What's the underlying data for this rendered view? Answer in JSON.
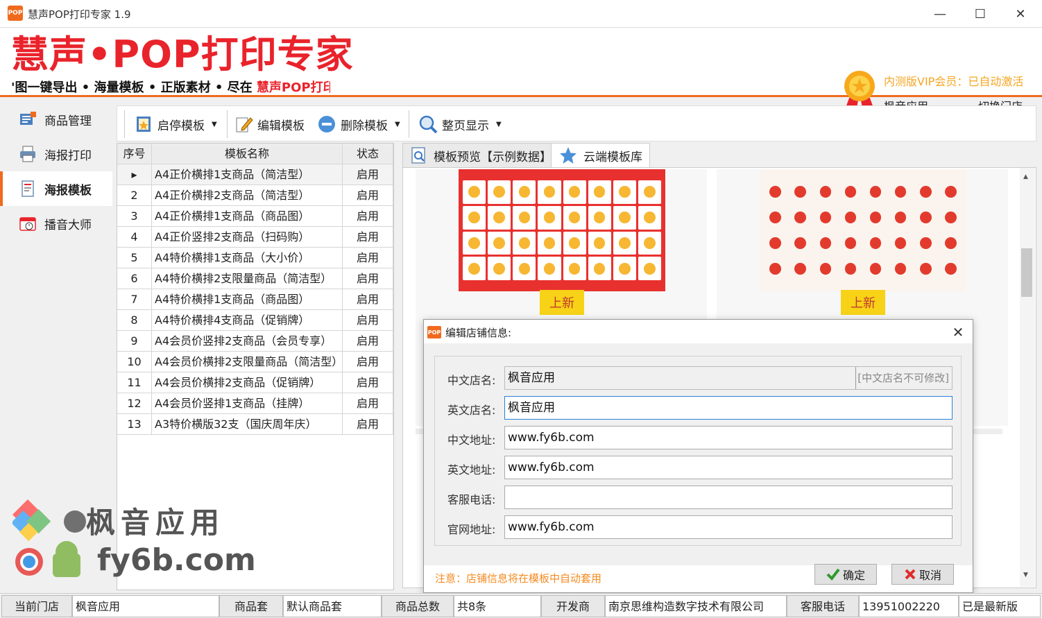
{
  "window": {
    "title": "慧声POP打印专家 1.9",
    "icon_text": "POP"
  },
  "header": {
    "logo": "慧声•POP打印专家",
    "slogan_prefix": "'图一键导出 • 海量模板 • 正版素材 • 尽在 ",
    "slogan_highlight": "慧声POP打印",
    "vip_text": "内测版VIP会员：已自动激活",
    "store_name": "枫音应用",
    "switch_store": "切换门店"
  },
  "sidebar": {
    "items": [
      {
        "label": "商品管理",
        "icon": "goods-icon"
      },
      {
        "label": "海报打印",
        "icon": "printer-icon"
      },
      {
        "label": "海报模板",
        "icon": "template-icon",
        "active": true
      },
      {
        "label": "播音大师",
        "icon": "broadcast-icon"
      }
    ]
  },
  "toolbar": {
    "toggle_label": "启停模板",
    "edit_label": "编辑模板",
    "delete_label": "删除模板",
    "zoom_label": "整页显示"
  },
  "grid": {
    "headers": [
      "序号",
      "模板名称",
      "状态"
    ],
    "rows": [
      [
        "▸",
        "A4正价横排1支商品（简洁型）",
        "启用"
      ],
      [
        "2",
        "A4正价横排2支商品（简洁型）",
        "启用"
      ],
      [
        "3",
        "A4正价横排1支商品（商品图）",
        "启用"
      ],
      [
        "4",
        "A4正价竖排2支商品（扫码购）",
        "启用"
      ],
      [
        "5",
        "A4特价横排1支商品（大小价）",
        "启用"
      ],
      [
        "6",
        "A4特价横排2支限量商品（简洁型）",
        "启用"
      ],
      [
        "7",
        "A4特价横排1支商品（商品图）",
        "启用"
      ],
      [
        "8",
        "A4特价横排4支商品（促销牌）",
        "启用"
      ],
      [
        "9",
        "A4会员价竖排2支商品（会员专享）",
        "启用"
      ],
      [
        "10",
        "A4会员价横排2支限量商品（简洁型）",
        "启用"
      ],
      [
        "11",
        "A4会员价横排2支商品（促销牌）",
        "启用"
      ],
      [
        "12",
        "A4会员价竖排1支商品（挂牌）",
        "启用"
      ],
      [
        "13",
        "A3特价横版32支（国庆周年庆）",
        "启用"
      ]
    ]
  },
  "tabs": [
    {
      "label": "模板预览【示例数据】"
    },
    {
      "label": "云端模板库",
      "active": true
    }
  ],
  "preview": {
    "badge_new": "上新"
  },
  "dialog": {
    "icon_text": "POP",
    "title": "编辑店铺信息:",
    "fields": {
      "cn_name_label": "中文店名:",
      "cn_name_value": "枫音应用",
      "cn_name_hint": "[中文店名不可修改]",
      "en_name_label": "英文店名:",
      "en_name_value": "枫音应用",
      "cn_addr_label": "中文地址:",
      "cn_addr_value": "www.fy6b.com",
      "en_addr_label": "英文地址:",
      "en_addr_value": "www.fy6b.com",
      "phone_label": "客服电话:",
      "phone_value": "",
      "site_label": "官网地址:",
      "site_value": "www.fy6b.com"
    },
    "note": "注意：店铺信息将在模板中自动套用",
    "ok_label": "确定",
    "cancel_label": "取消"
  },
  "statusbar": {
    "store_label": "当前门店",
    "store_value": "枫音应用",
    "set_label": "商品套",
    "set_value": "默认商品套",
    "total_label": "商品总数",
    "total_value": "共8条",
    "dev_label": "开发商",
    "dev_value": "南京思维构造数字技术有限公司",
    "phone_label": "客服电话",
    "phone_value": "13951002220",
    "version": "已是最新版"
  },
  "watermark": {
    "brand": "枫音应用",
    "url": "fy6b.com"
  },
  "colors": {
    "accent": "#f06a1d",
    "logo_red": "#e9232b",
    "vip": "#f5a623"
  }
}
